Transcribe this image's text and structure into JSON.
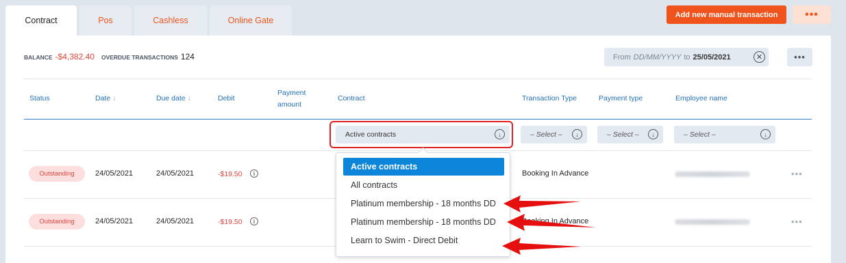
{
  "tabs": [
    "Contract",
    "Pos",
    "Cashless",
    "Online Gate"
  ],
  "actions": {
    "add_manual": "Add new manual transaction",
    "more": "•••"
  },
  "summary": {
    "balance_label": "BALANCE",
    "balance_value": "-$4,382.40",
    "overdue_label": "OVERDUE TRANSACTIONS",
    "overdue_value": "124"
  },
  "date_filter": {
    "from_label": "From",
    "from_placeholder": "DD/MM/YYYY",
    "to_label": "to",
    "to_value": "25/05/2021"
  },
  "columns": {
    "status": "Status",
    "date": "Date",
    "due_date": "Due date",
    "debit": "Debit",
    "payment_amount_1": "Payment",
    "payment_amount_2": "amount",
    "contract": "Contract",
    "transaction_type": "Transaction Type",
    "payment_type": "Payment type",
    "employee_name": "Employee name"
  },
  "filters": {
    "contract": "Active contracts",
    "transaction_type": "– Select –",
    "payment_type": "– Select –",
    "employee_name": "– Select –"
  },
  "contract_options": [
    "Active contracts",
    "All contracts",
    "Platinum membership - 18 months DD",
    "Platinum membership - 18 months DD",
    "Learn to Swim - Direct Debit"
  ],
  "rows": [
    {
      "status": "Outstanding",
      "date": "24/05/2021",
      "due_date": "24/05/2021",
      "debit": "-$19.50",
      "transaction_type": "Booking In Advance"
    },
    {
      "status": "Outstanding",
      "date": "24/05/2021",
      "due_date": "24/05/2021",
      "debit": "-$19.50",
      "transaction_type": "Booking In Advance"
    }
  ],
  "colors": {
    "accent": "#f0531c",
    "link": "#1f6fb8",
    "negative": "#e0443a",
    "selected": "#0b86d8",
    "annotation": "#e02020"
  }
}
